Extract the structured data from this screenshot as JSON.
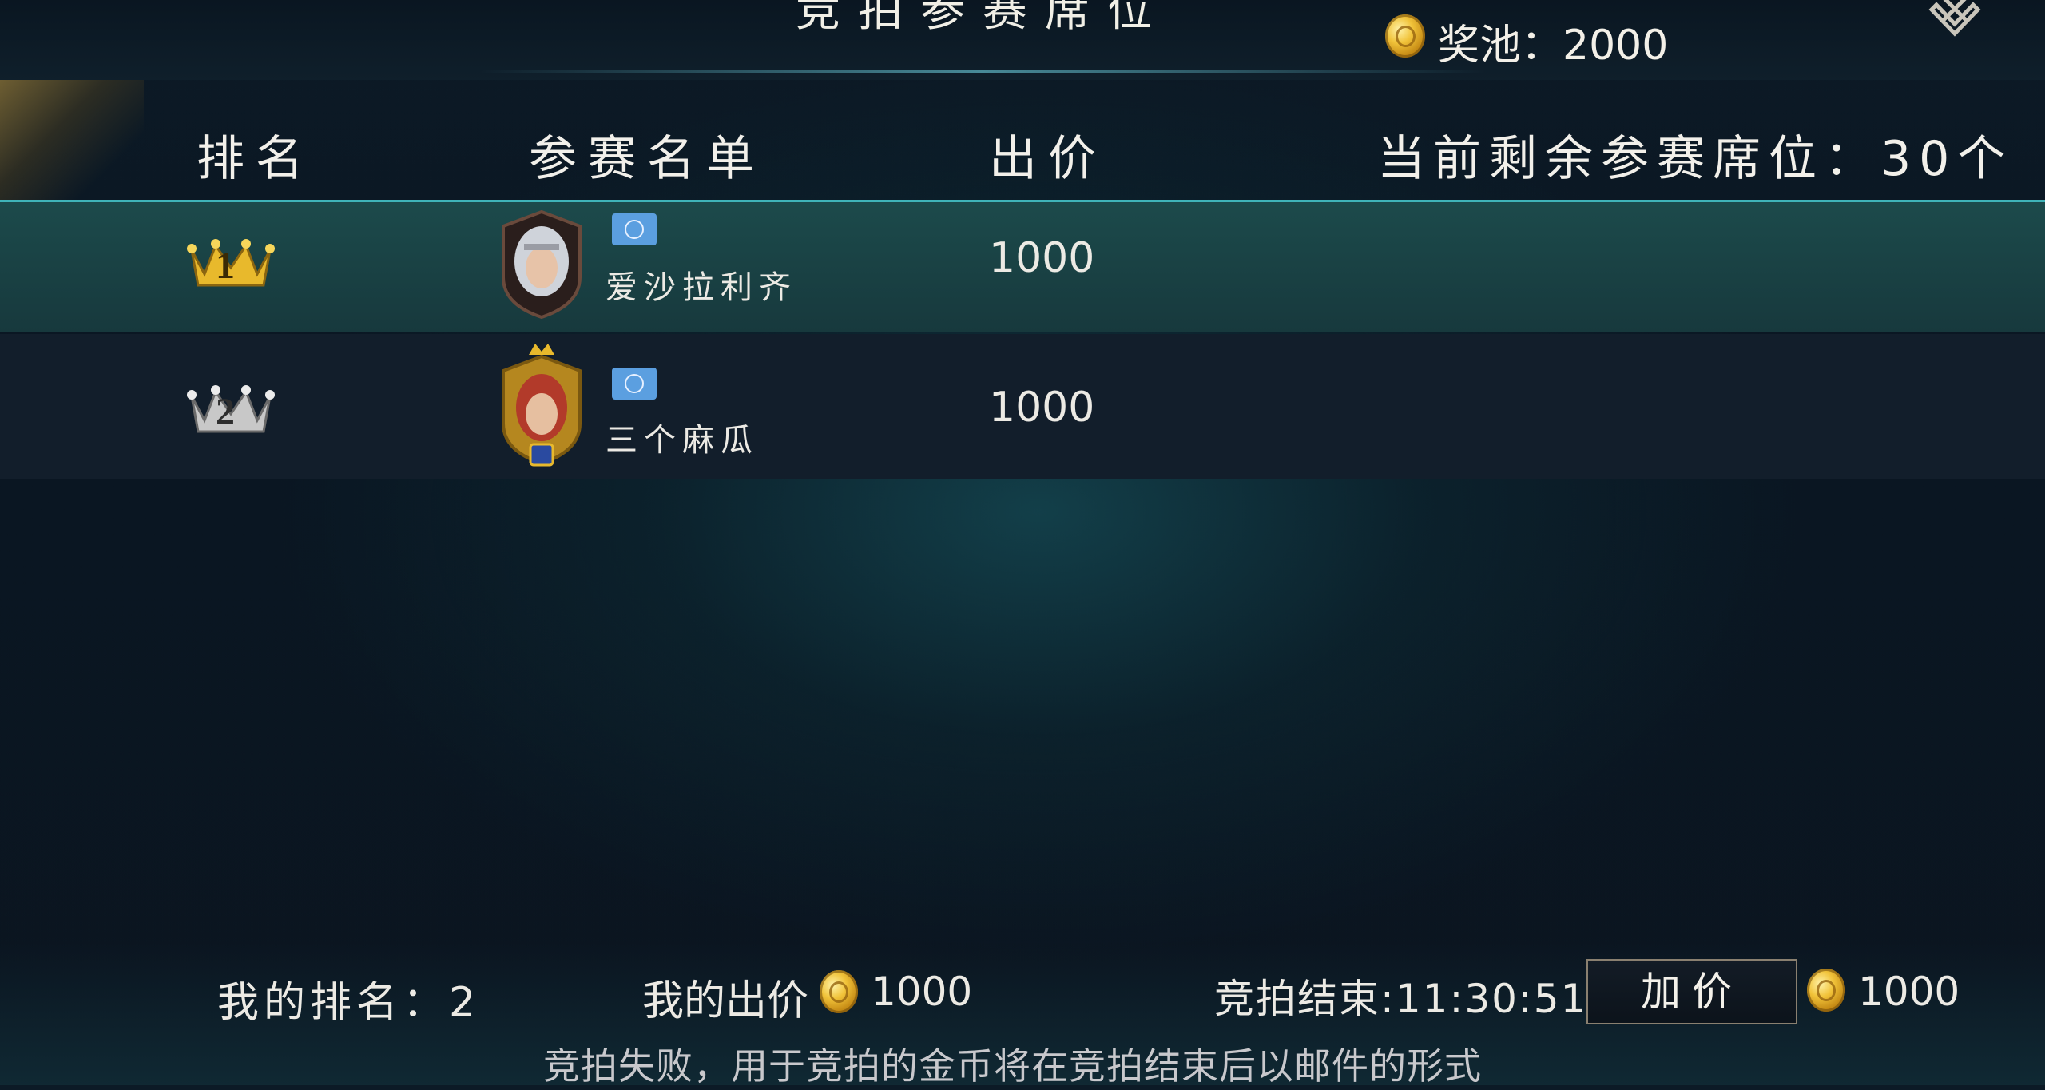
{
  "header": {
    "title": "竞拍参赛席位",
    "prize_pool": "奖池：2000"
  },
  "columns": {
    "rank": "排名",
    "roster": "参赛名单",
    "bid": "出价",
    "seats_remaining": "当前剩余参赛席位：30个"
  },
  "rows": [
    {
      "rank": "1",
      "name": "爱沙拉利齐",
      "bid": "1000"
    },
    {
      "rank": "2",
      "name": "三个麻瓜",
      "bid": "1000"
    }
  ],
  "footer": {
    "my_rank": "我的排名：2",
    "my_bid_label": "我的出价",
    "my_bid_value": "1000",
    "auction_end": "竞拍结束:11:30:51",
    "raise_button": "加价",
    "raise_amount": "1000",
    "notice": "竞拍失败，用于竞拍的金币将在竞拍结束后以邮件的形式"
  },
  "colors": {
    "highlight_row": "#1c4a4b",
    "accent_line": "#3fb3b8",
    "gold": "#f1c33a",
    "flag": "#5b9fe0"
  },
  "icons": [
    "coin-icon",
    "close-icon",
    "crown-gold-icon",
    "crown-silver-icon",
    "un-flag-icon"
  ]
}
